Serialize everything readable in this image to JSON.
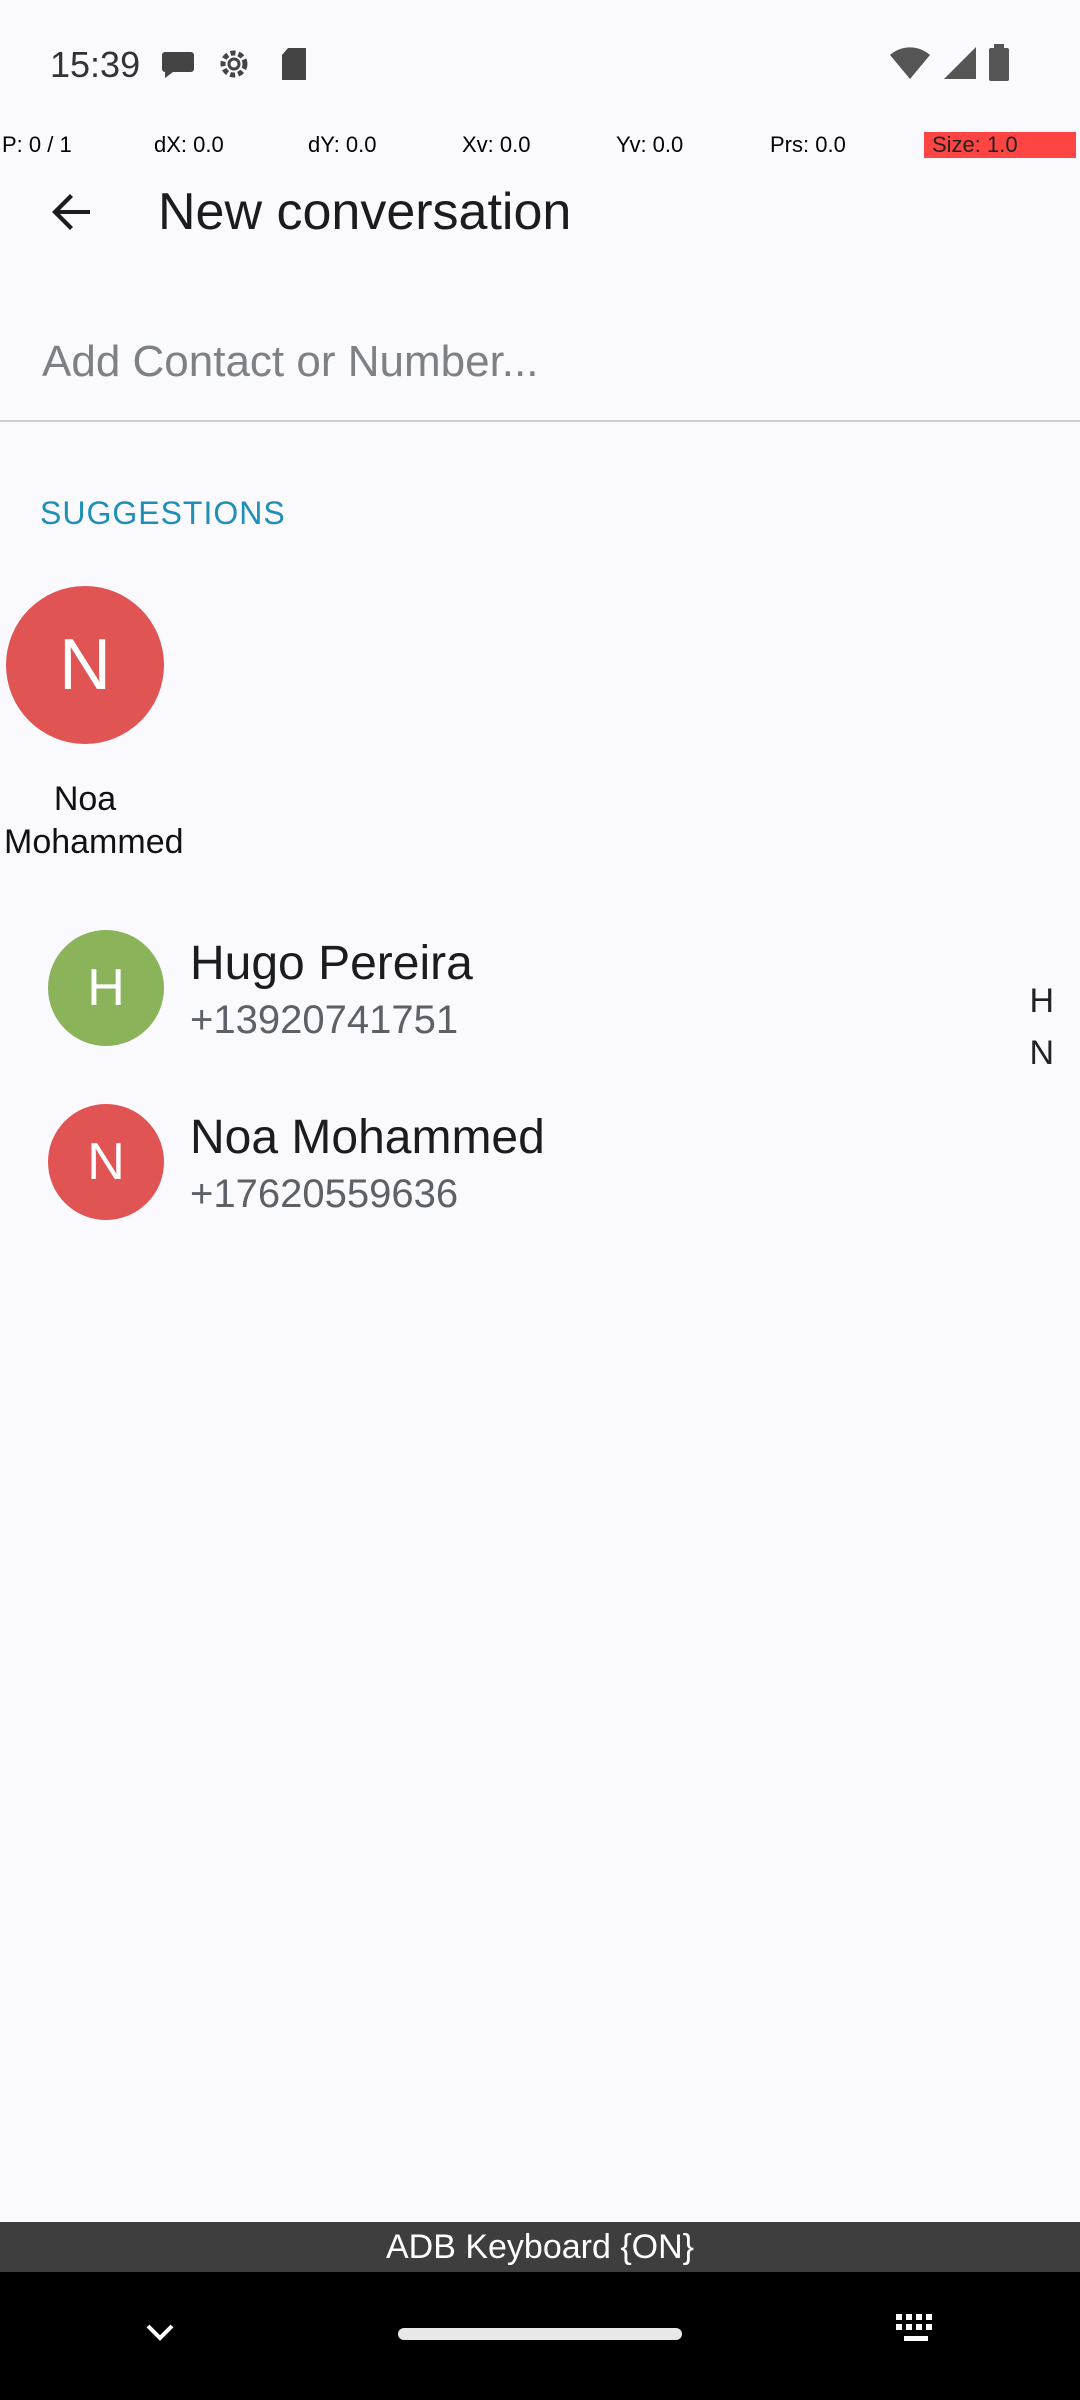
{
  "status_bar": {
    "time": "15:39",
    "left_icons": [
      "chat-bubble-icon",
      "gear-icon",
      "sd-card-icon"
    ],
    "right_icons": [
      "wifi-icon",
      "signal-icon",
      "battery-icon"
    ]
  },
  "debug_bar": {
    "p": "P: 0 / 1",
    "dx": "dX: 0.0",
    "dy": "dY: 0.0",
    "xv": "Xv: 0.0",
    "yv": "Yv: 0.0",
    "prs": "Prs: 0.0",
    "size": "Size: 1.0"
  },
  "app_bar": {
    "back_icon": "arrow-back-icon",
    "title": "New conversation"
  },
  "search": {
    "placeholder": "Add Contact or Number...",
    "value": ""
  },
  "suggestions": {
    "label": "SUGGESTIONS",
    "items": [
      {
        "initial": "N",
        "name": "Noa Mohammed",
        "color": "#E05454"
      }
    ]
  },
  "contacts": [
    {
      "initial": "H",
      "name": "Hugo Pereira",
      "phone": "+13920741751",
      "color": "#8BB35A"
    },
    {
      "initial": "N",
      "name": "Noa Mohammed",
      "phone": "+17620559636",
      "color": "#E05454"
    }
  ],
  "index_letters": [
    "H",
    "N"
  ],
  "keyboard_bar": {
    "label": "ADB Keyboard {ON}"
  },
  "nav_bar": {
    "icons": [
      "chevron-down-icon",
      "home-pill",
      "keyboard-icon"
    ]
  },
  "colors": {
    "background": "#F9F9FE",
    "accent": "#1E90B5"
  }
}
